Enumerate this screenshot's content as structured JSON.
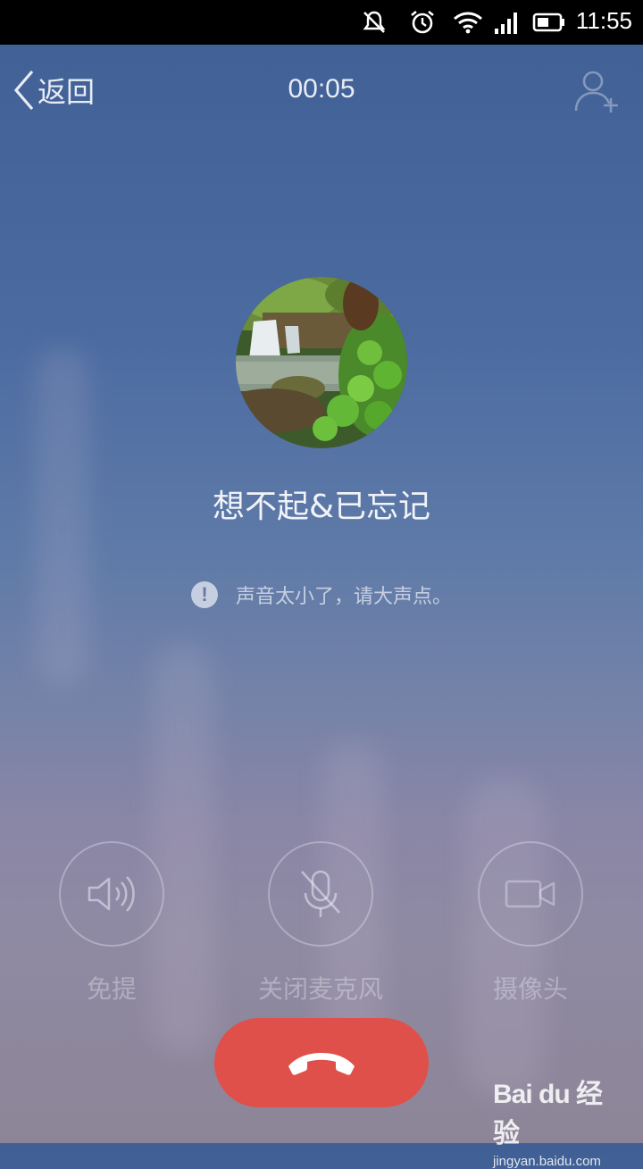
{
  "status_bar": {
    "time": "11:55",
    "icons": [
      "mute-icon",
      "alarm-icon",
      "wifi-icon",
      "signal-icon",
      "battery-icon"
    ]
  },
  "header": {
    "back_label": "返回",
    "timer": "00:05",
    "add_user_icon": "add-user-icon"
  },
  "contact": {
    "name": "想不起&已忘记"
  },
  "notice": {
    "icon": "exclamation-icon",
    "text": "声音太小了，请大声点。"
  },
  "controls": [
    {
      "label": "免提",
      "icon": "speaker-icon"
    },
    {
      "label": "关闭麦克风",
      "icon": "mic-off-icon"
    },
    {
      "label": "摄像头",
      "icon": "camera-icon"
    }
  ],
  "hangup": {
    "icon": "hangup-icon",
    "color": "#e0504a"
  },
  "watermark": {
    "logo": "Bai du 经验",
    "url": "jingyan.baidu.com"
  }
}
